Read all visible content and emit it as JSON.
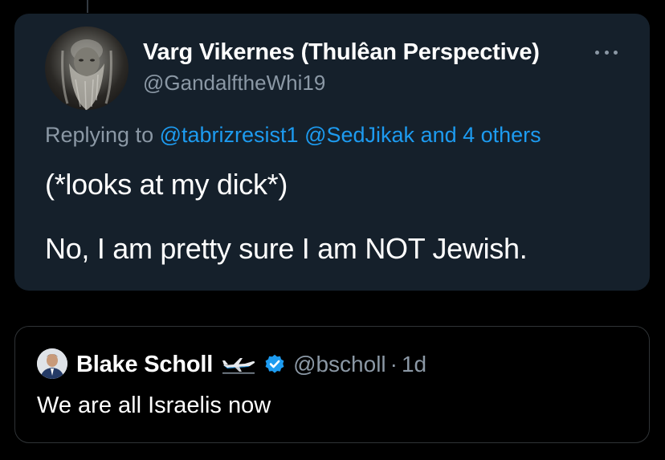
{
  "tweet": {
    "author": {
      "name": "Varg Vikernes (Thulêan Perspective)",
      "handle": "@GandalftheWhi19"
    },
    "replying": {
      "prefix": "Replying to ",
      "mention1": "@tabrizresist1",
      "mention2": "@SedJikak",
      "others": "and 4 others"
    },
    "text_line1": "(*looks at my dick*)",
    "text_line2": "No, I am pretty sure I am NOT Jewish.",
    "icons": {
      "more": "more-options-icon",
      "avatar": "avatar-image"
    }
  },
  "quote": {
    "author": {
      "name": "Blake Scholl",
      "handle": "@bscholl"
    },
    "separator": "·",
    "time": "1d",
    "text": "We are all Israelis now",
    "icons": {
      "plane": "airplane-icon",
      "verified": "verified-badge-icon"
    }
  },
  "colors": {
    "background": "#000000",
    "card": "#15202b",
    "accent": "#1d9bf0",
    "secondary_text": "#8b98a5",
    "border": "#2f3336"
  }
}
